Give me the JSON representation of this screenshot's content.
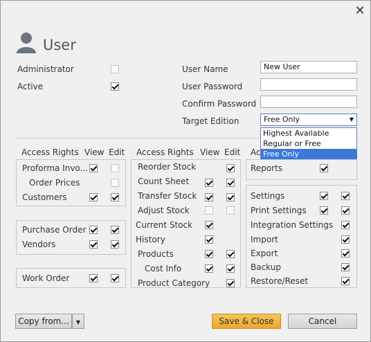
{
  "title": "User",
  "fields": {
    "administrator_label": "Administrator",
    "administrator_checked": false,
    "active_label": "Active",
    "active_checked": true,
    "user_name_label": "User Name",
    "user_name_value": "New User",
    "user_password_label": "User Password",
    "user_password_value": "",
    "confirm_password_label": "Confirm Password",
    "confirm_password_value": "",
    "target_edition_label": "Target Edition",
    "target_edition_value": "Free Only",
    "target_edition_options": [
      "Highest Available",
      "Regular or Free",
      "Free Only"
    ]
  },
  "headers": {
    "access_rights": "Access Rights",
    "view": "View",
    "edit": "Edit",
    "col3_access_partial": "Ac"
  },
  "col1": {
    "group1": [
      {
        "label": "Proforma Invo...",
        "view": true,
        "edit": false,
        "edit_enabled": false
      },
      {
        "label": "Order Prices",
        "view": false,
        "view_enabled": false
      },
      {
        "label": "Customers",
        "view": true,
        "edit": true
      }
    ],
    "group2": [
      {
        "label": "Purchase Order",
        "view": true,
        "edit": true
      },
      {
        "label": "Vendors",
        "view": true,
        "edit": true
      }
    ],
    "group3": [
      {
        "label": "Work Order",
        "view": true,
        "edit": true
      }
    ]
  },
  "col2": [
    {
      "label": "Reorder Stock",
      "edit": true
    },
    {
      "label": "Count Sheet",
      "view": true,
      "edit": true
    },
    {
      "label": "Transfer Stock",
      "view": true,
      "edit": true
    },
    {
      "label": "Adjust Stock",
      "view": false,
      "edit": false
    },
    {
      "label": "Current Stock",
      "view": true
    },
    {
      "label": "History",
      "view": true
    },
    {
      "label": "Products",
      "view": true,
      "edit": true
    },
    {
      "label": "Cost Info",
      "view": true,
      "edit": true
    },
    {
      "label": "Product Category",
      "edit": true
    }
  ],
  "col3": {
    "reports": {
      "label": "Reports",
      "view": true
    },
    "list": [
      {
        "label": "Settings",
        "view": true,
        "edit": true
      },
      {
        "label": "Print Settings",
        "view": true,
        "edit": true
      },
      {
        "label": "Integration Settings",
        "edit": true
      },
      {
        "label": "Import",
        "edit": true
      },
      {
        "label": "Export",
        "edit": true
      },
      {
        "label": "Backup",
        "edit": true
      },
      {
        "label": "Restore/Reset",
        "edit": true
      }
    ]
  },
  "buttons": {
    "copy_from": "Copy from...",
    "save_close": "Save & Close",
    "cancel": "Cancel"
  },
  "colors": {
    "accent": "#3b78d8",
    "save_button": "#eaa62e"
  }
}
